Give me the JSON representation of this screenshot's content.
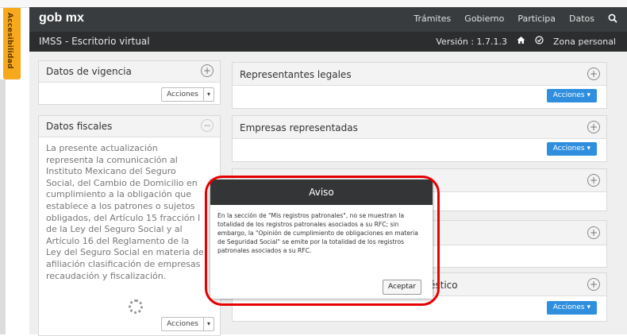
{
  "accessibility": {
    "label": "Accesibilidad"
  },
  "header": {
    "logo": "gob mx",
    "nav": [
      "Trámites",
      "Gobierno",
      "Participa",
      "Datos"
    ]
  },
  "subheader": {
    "title": "IMSS - Escritorio virtual",
    "version": "Versión : 1.7.1.3",
    "personal": "Zona personal"
  },
  "panels": {
    "vigencia": {
      "title": "Datos de vigencia",
      "actions": "Acciones"
    },
    "fiscales": {
      "title": "Datos fiscales",
      "text": "La presente actualización representa la comunicación al Instituto Mexicano del Seguro Social, del Cambio de Domicilio en cumplimiento a la obligación que establece a los patrones o sujetos obligados, del Artículo 15 fracción I de la Ley del Seguro Social y al Artículo 16 del Reglamento de la Ley del Seguro Social en materia de afiliación clasificación de empresas recaudación y fiscalización.",
      "actions": "Acciones"
    },
    "representantes": {
      "title": "Representantes legales",
      "actions": "Acciones"
    },
    "empresas": {
      "title": "Empresas representadas",
      "actions": "Acciones"
    },
    "domestico": {
      "title_partial": "éstico",
      "actions": "Acciones"
    }
  },
  "modal": {
    "title": "Aviso",
    "message": "En la sección de \"Mis registros patronales\", no se muestran la totalidad de los registros patronales asociados a su RFC; sin embargo, la \"Opinión de cumplimiento de obligaciones en materia de Seguridad Social\" se emite por la totalidad de los registros patronales asociados a su RFC.",
    "accept": "Aceptar"
  },
  "colors": {
    "accent": "#2f8fde",
    "header": "#393c3e",
    "highlight": "#e60000",
    "accessibility": "#f7a81b"
  }
}
